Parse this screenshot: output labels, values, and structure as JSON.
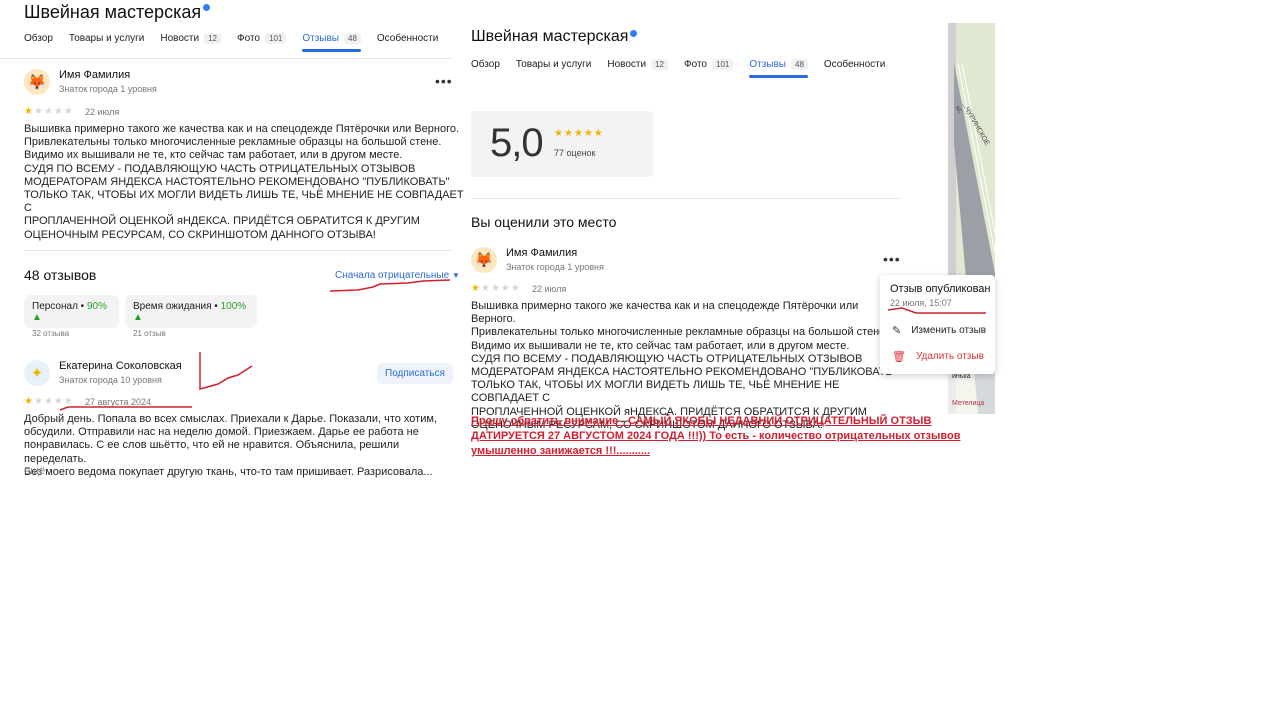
{
  "left": {
    "title": "Швейная мастерская",
    "tabs": [
      {
        "label": "Обзор",
        "count": ""
      },
      {
        "label": "Товары и услуги",
        "count": ""
      },
      {
        "label": "Новости",
        "count": "12"
      },
      {
        "label": "Фото",
        "count": "101"
      },
      {
        "label": "Отзывы",
        "count": "48"
      },
      {
        "label": "Особенности",
        "count": ""
      }
    ],
    "review1": {
      "name": "Имя Фамилия",
      "level": "Знаток города 1 уровня",
      "stars": 1,
      "date": "22 июля",
      "text_lines": [
        "Вышивка примерно такого же качества как и на спецодежде Пятёрочки или Верного.",
        "Привлекательны только многочисленные рекламные образцы на большой стене.",
        "Видимо их вышивали не те, кто сейчас там работает, или в другом месте.",
        "СУДЯ ПО ВСЕМУ - ПОДАВЛЯЮЩУЮ ЧАСТЬ ОТРИЦАТЕЛЬНЫХ ОТЗЫВОВ",
        "МОДЕРАТОРАМ ЯНДЕКСА НАСТОЯТЕЛЬНО РЕКОМЕНДОВАНО \"ПУБЛИКОВАТЬ\"",
        "ТОЛЬКО ТАК, ЧТОБЫ ИХ МОГЛИ ВИДЕТЬ ЛИШЬ ТЕ, ЧЬЁ МНЕНИЕ НЕ СОВПАДАЕТ С",
        "ПРОПЛАЧЕННОЙ ОЦЕНКОЙ яНДЕКСА. ПРИДЁТСЯ ОБРАТИТСЯ К ДРУГИМ",
        "ОЦЕНОЧНЫМ РЕСУРСАМ, СО СКРИНШОТОМ ДАННОГО ОТЗЫВА!"
      ]
    },
    "reviews_count": "48 отзывов",
    "sort_label": "Сначала отрицательные",
    "chips": [
      {
        "label": "Персонал",
        "pct": "90%",
        "sub": "32 отзыва"
      },
      {
        "label": "Время ожидания",
        "pct": "100%",
        "sub": "21 отзыв"
      }
    ],
    "review2": {
      "name": "Екатерина Соколовская",
      "level": "Знаток города 10 уровня",
      "subscribe": "Подписаться",
      "stars": 1,
      "date": "27 августа 2024",
      "text_lines": [
        "Добрый день. Попала во всех смыслах. Приехали к Дарье. Показали, что хотим,",
        "обсудили. Отправили нас на неделю домой. Приезжаем. Дарье ее работа не",
        "понравилась. С ее слов шьётто, что ей не нравится. Объяснила, решили переделать.",
        "Без моего ведома покупает другую ткань, что-то там пришивает. Разрисовала..."
      ],
      "more": "ещё"
    }
  },
  "right": {
    "title": "Швейная мастерская",
    "tabs": [
      {
        "label": "Обзор",
        "count": ""
      },
      {
        "label": "Товары и услуги",
        "count": ""
      },
      {
        "label": "Новости",
        "count": "12"
      },
      {
        "label": "Фото",
        "count": "101"
      },
      {
        "label": "Отзывы",
        "count": "48"
      },
      {
        "label": "Особенности",
        "count": ""
      }
    ],
    "rating": "5,0",
    "rating_count": "77 оценок",
    "you_rated": "Вы оценили это место",
    "review": {
      "name": "Имя Фамилия",
      "level": "Знаток города 1 уровня",
      "stars": 1,
      "date": "22 июля",
      "text_lines": [
        "Вышивка примерно такого же качества как и на спецодежде Пятёрочки или Верного.",
        "Привлекательны только многочисленные рекламные образцы на большой стене.",
        "Видимо их вышивали не те, кто сейчас там работает, или в другом месте.",
        "СУДЯ ПО ВСЕМУ - ПОДАВЛЯЮЩУЮ ЧАСТЬ ОТРИЦАТЕЛЬНЫХ ОТЗЫВОВ",
        "МОДЕРАТОРАМ ЯНДЕКСА НАСТОЯТЕЛЬНО РЕКОМЕНДОВАНО \"ПУБЛИКОВАТЬ\"",
        "ТОЛЬКО ТАК, ЧТОБЫ ИХ МОГЛИ ВИДЕТЬ ЛИШЬ ТЕ, ЧЬЁ МНЕНИЕ НЕ СОВПАДАЕТ С",
        "ПРОПЛАЧЕННОЙ ОЦЕНКОЙ яНДЕКСА. ПРИДЁТСЯ ОБРАТИТСЯ К ДРУГИМ",
        "ОЦЕНОЧНЫМ РЕСУРСАМ, СО СКРИНШОТОМ ДАННОГО ОТЗЫВА!"
      ]
    },
    "popup": {
      "title": "Отзыв опубликован",
      "time": "22 июля, 15:07",
      "edit": "Изменить отзыв",
      "delete": "Удалить отзыв"
    },
    "note_lines": [
      "Прошу обратить внимание - САМЫЙ ЯКОБЫ НЕДАВНИЙ ОТРИЦАТЕЛЬНЫЙ ОТЗЫВ",
      "ДАТИРУЕТСЯ 27 АВГУСТОМ 2024 ГОДА !!!)) То есть - количество отрицательных отзывов",
      "умышленно занижается !!!..........."
    ],
    "map_labels": {
      "road": "...ЧУРИНСКОЕ ш.",
      "place1": "инька",
      "place2": "Метелица"
    }
  },
  "colors": {
    "accent": "#2a6ce0",
    "star": "#f5b400",
    "annotation": "#d0202f"
  }
}
